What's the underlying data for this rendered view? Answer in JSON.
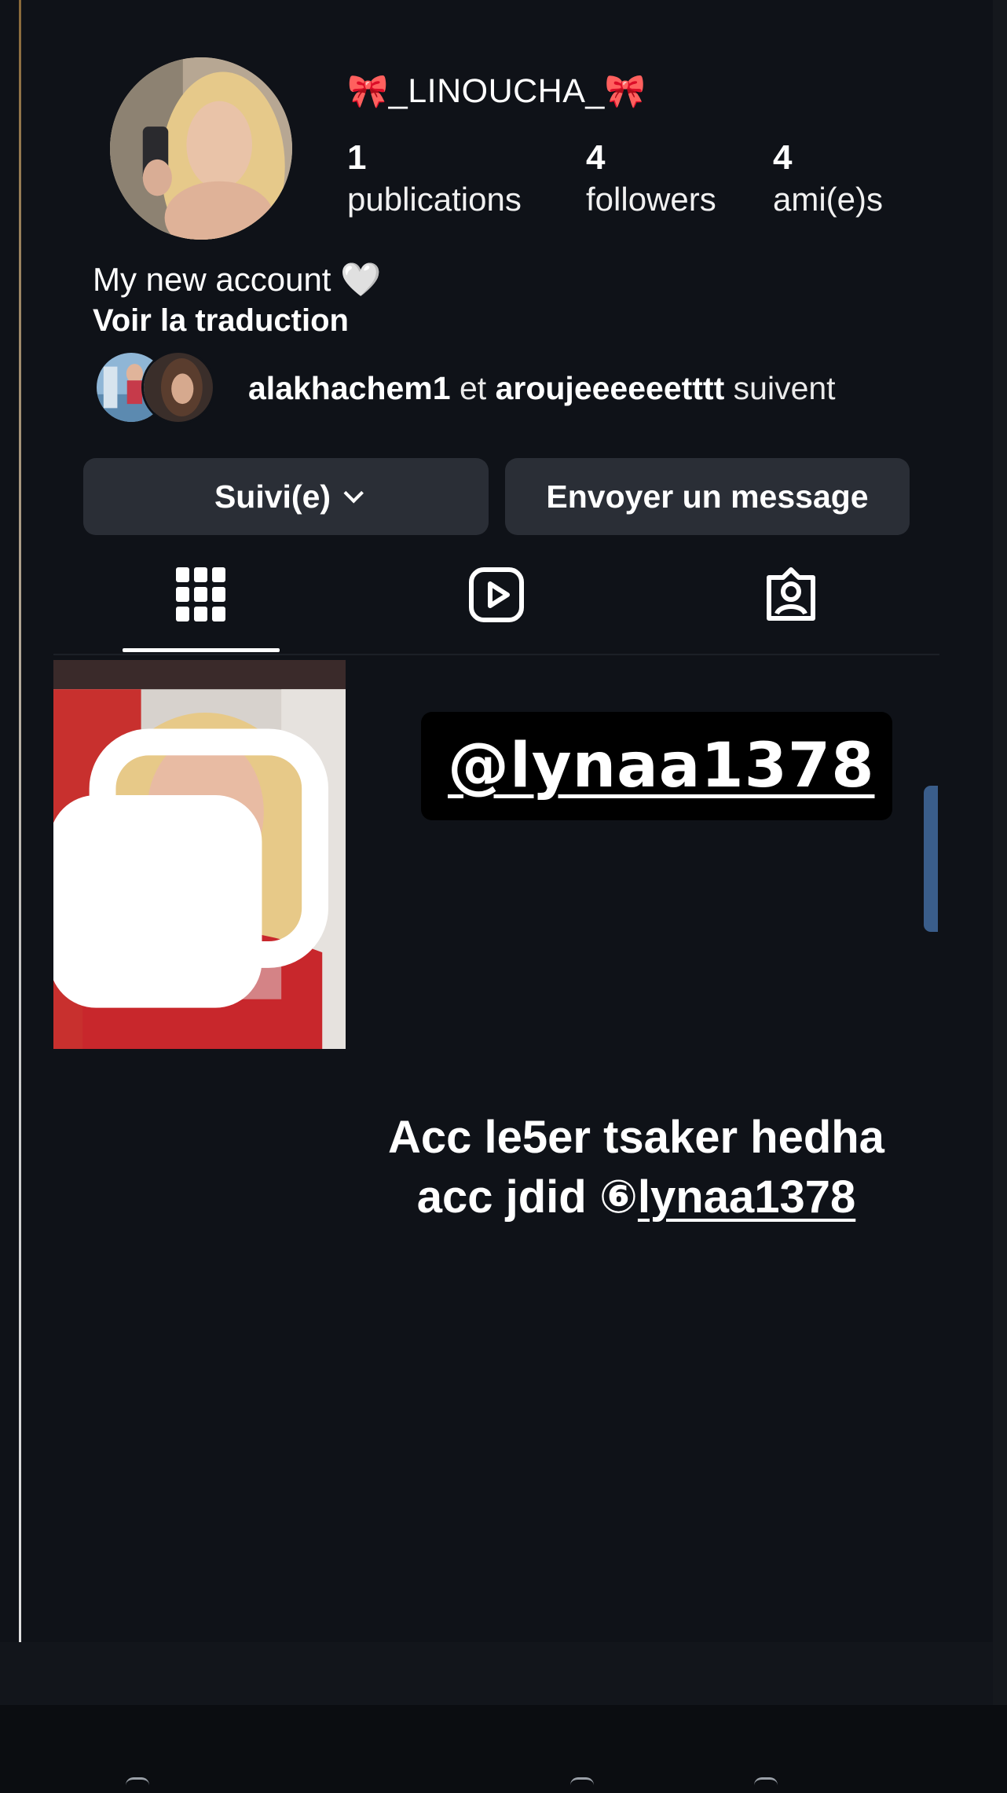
{
  "profile": {
    "username": "_LINOUCHA_",
    "bow_emoji": "🎀",
    "stats": [
      {
        "value": "1",
        "label": "publications"
      },
      {
        "value": "4",
        "label": "followers"
      },
      {
        "value": "4",
        "label": "ami(e)s"
      }
    ],
    "bio": "My new account 🤍",
    "translate_link": "Voir la traduction",
    "mutual": {
      "user1": "alakhachem1",
      "connector": "et",
      "user2": "aroujeeeeeetttt",
      "suffix": "suivent"
    }
  },
  "actions": {
    "follow_label": "Suivi(e)",
    "message_label": "Envoyer un message"
  },
  "tabs": [
    {
      "icon": "grid-icon",
      "active": true
    },
    {
      "icon": "reels-icon",
      "active": false
    },
    {
      "icon": "tagged-icon",
      "active": false
    }
  ],
  "overlay": {
    "handle": "@lynaa1378",
    "caption_line1": "Acc le5er tsaker hedha",
    "caption_line2_prefix": "acc jdid ",
    "caption_line2_symbol": "⑥",
    "caption_line2_link": "lynaa1378"
  },
  "colors": {
    "background": "#0f1218",
    "button": "#2a2e36",
    "bow": "#e2283a",
    "scroll_accent": "#3a5d8a"
  }
}
